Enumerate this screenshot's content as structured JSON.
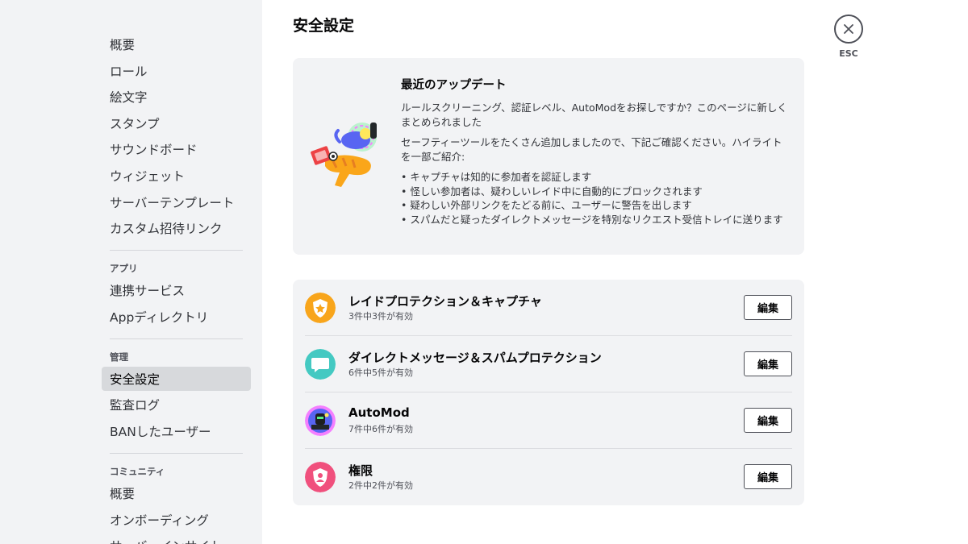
{
  "sidebar": {
    "group1": [
      "概要",
      "ロール",
      "絵文字",
      "スタンプ",
      "サウンドボード",
      "ウィジェット",
      "サーバーテンプレート",
      "カスタム招待リンク"
    ],
    "apps_header": "アプリ",
    "apps": [
      "連携サービス",
      "Appディレクトリ"
    ],
    "moderation_header": "管理",
    "moderation": [
      "安全設定",
      "監査ログ",
      "BANしたユーザー"
    ],
    "community_header": "コミュニティ",
    "community": [
      "概要",
      "オンボーディング",
      "サーバーインサイト"
    ]
  },
  "page": {
    "title": "安全設定"
  },
  "update": {
    "title": "最近のアップデート",
    "p1": "ルールスクリーニング、認証レベル、AutoModをお探しですか？このページに新しくまとめられました",
    "p2": "セーフティーツールをたくさん追加しましたので、下記ご確認ください。ハイライトを一部ご紹介:",
    "bullets": [
      "• キャプチャは知的に参加者を認証します",
      "• 怪しい参加者は、疑わしいレイド中に自動的にブロックされます",
      "• 疑わしい外部リンクをたどる前に、ユーザーに警告を出します",
      "• スパムだと疑ったダイレクトメッセージを特別なリクエスト受信トレイに送ります"
    ]
  },
  "settings": [
    {
      "name": "レイドプロテクション＆キャプチャ",
      "status": "3件中3件が有効",
      "button": "編集",
      "icon": "shield-star-icon",
      "color": "#f8a51b"
    },
    {
      "name": "ダイレクトメッセージ＆スパムプロテクション",
      "status": "6件中5件が有効",
      "button": "編集",
      "icon": "message-icon",
      "color": "#3ed3a9"
    },
    {
      "name": "AutoMod",
      "status": "7件中6件が有効",
      "button": "編集",
      "icon": "automod-robot-icon",
      "color": "#5865f2"
    },
    {
      "name": "権限",
      "status": "2件中2件が有効",
      "button": "編集",
      "icon": "shield-person-icon",
      "color": "#f0507d"
    }
  ],
  "close": {
    "label": "ESC"
  }
}
